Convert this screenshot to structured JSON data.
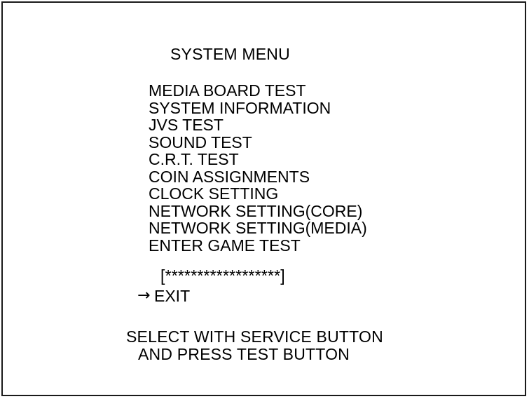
{
  "title": "SYSTEM MENU",
  "menu_items": [
    "MEDIA BOARD TEST",
    "SYSTEM INFORMATION",
    "JVS TEST",
    "SOUND TEST",
    "C.R.T. TEST",
    "COIN ASSIGNMENTS",
    "CLOCK SETTING",
    "NETWORK SETTING(CORE)",
    "NETWORK SETTING(MEDIA)",
    "ENTER GAME TEST"
  ],
  "progress_text": "[******************]",
  "cursor_glyph": "→",
  "exit_label": "EXIT",
  "instructions": {
    "line1": "SELECT WITH SERVICE BUTTON",
    "line2": "AND PRESS TEST BUTTON"
  },
  "colors": {
    "background": "#ffffff",
    "text": "#000000",
    "border": "#1a1a1a"
  }
}
